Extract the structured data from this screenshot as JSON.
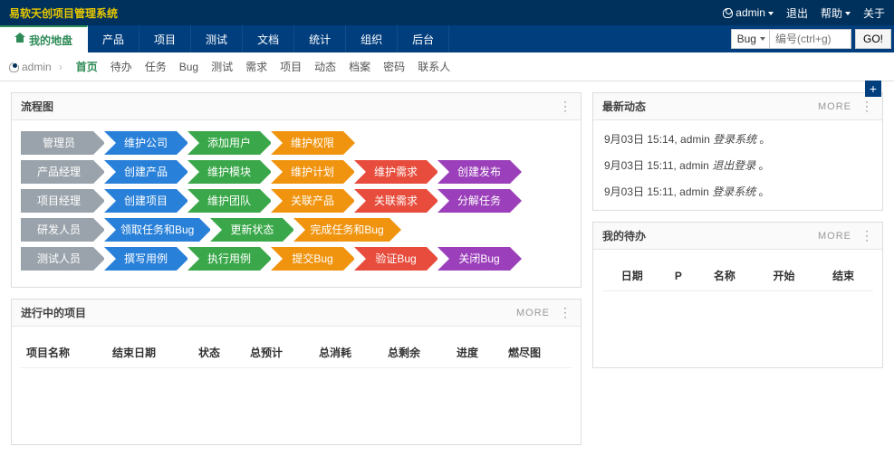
{
  "brand": "易软天创项目管理系统",
  "top": {
    "user": "admin",
    "logout": "退出",
    "help": "帮助",
    "about": "关于"
  },
  "nav": {
    "tabs": [
      "我的地盘",
      "产品",
      "项目",
      "测试",
      "文档",
      "统计",
      "组织",
      "后台"
    ],
    "active": 0
  },
  "search": {
    "type": "Bug",
    "placeholder": "编号(ctrl+g)",
    "go": "GO!"
  },
  "subnav": {
    "user": "admin",
    "items": [
      "首页",
      "待办",
      "任务",
      "Bug",
      "测试",
      "需求",
      "项目",
      "动态",
      "档案",
      "密码",
      "联系人"
    ],
    "active": 0
  },
  "panels": {
    "flow": {
      "title": "流程图"
    },
    "activity": {
      "title": "最新动态",
      "more": "MORE",
      "items": [
        {
          "time": "9月03日 15:14",
          "who": "admin",
          "action": "登录系统",
          "suffix": "。"
        },
        {
          "time": "9月03日 15:11",
          "who": "admin",
          "action": "退出登录",
          "suffix": "。"
        },
        {
          "time": "9月03日 15:11",
          "who": "admin",
          "action": "登录系统",
          "suffix": "。"
        }
      ]
    },
    "projects": {
      "title": "进行中的项目",
      "more": "MORE",
      "cols": [
        "项目名称",
        "结束日期",
        "状态",
        "总预计",
        "总消耗",
        "总剩余",
        "进度",
        "燃尽图"
      ]
    },
    "todo": {
      "title": "我的待办",
      "more": "MORE",
      "cols": [
        "日期",
        "P",
        "名称",
        "开始",
        "结束"
      ]
    }
  },
  "flow_rows": [
    [
      {
        "t": "管理员",
        "c": "grey"
      },
      {
        "t": "维护公司",
        "c": "blue"
      },
      {
        "t": "添加用户",
        "c": "green"
      },
      {
        "t": "维护权限",
        "c": "orange"
      }
    ],
    [
      {
        "t": "产品经理",
        "c": "grey"
      },
      {
        "t": "创建产品",
        "c": "blue"
      },
      {
        "t": "维护模块",
        "c": "green"
      },
      {
        "t": "维护计划",
        "c": "orange"
      },
      {
        "t": "维护需求",
        "c": "red"
      },
      {
        "t": "创建发布",
        "c": "purple"
      }
    ],
    [
      {
        "t": "项目经理",
        "c": "grey"
      },
      {
        "t": "创建项目",
        "c": "blue"
      },
      {
        "t": "维护团队",
        "c": "green"
      },
      {
        "t": "关联产品",
        "c": "orange"
      },
      {
        "t": "关联需求",
        "c": "red"
      },
      {
        "t": "分解任务",
        "c": "purple"
      }
    ],
    [
      {
        "t": "研发人员",
        "c": "grey"
      },
      {
        "t": "领取任务和Bug",
        "c": "blue"
      },
      {
        "t": "更新状态",
        "c": "green"
      },
      {
        "t": "完成任务和Bug",
        "c": "orange"
      }
    ],
    [
      {
        "t": "测试人员",
        "c": "grey"
      },
      {
        "t": "撰写用例",
        "c": "blue"
      },
      {
        "t": "执行用例",
        "c": "green"
      },
      {
        "t": "提交Bug",
        "c": "orange"
      },
      {
        "t": "验证Bug",
        "c": "red"
      },
      {
        "t": "关闭Bug",
        "c": "purple"
      }
    ]
  ]
}
